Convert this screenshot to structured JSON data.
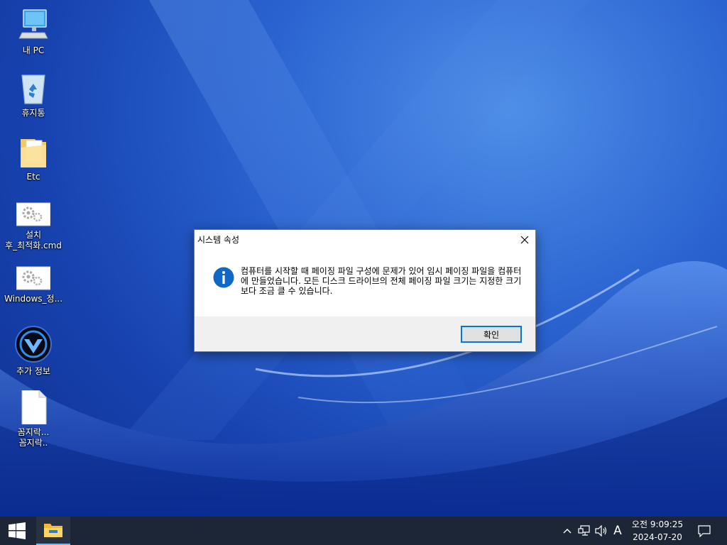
{
  "desktop": {
    "icons": [
      {
        "label": "내 PC",
        "icon": "computer-icon"
      },
      {
        "label": "휴지통",
        "icon": "recycle-bin-icon"
      },
      {
        "label": "Etc",
        "icon": "folder-icon"
      },
      {
        "label": "설치\n후_최적화.cmd",
        "icon": "settings-script-icon"
      },
      {
        "label": "Windows_정...",
        "icon": "settings-script-icon"
      },
      {
        "label": "추가 정보",
        "icon": "info-app-icon"
      },
      {
        "label": "꼼지락...\n꼼지락..",
        "icon": "file-icon"
      }
    ]
  },
  "dialog": {
    "title": "시스템 속성",
    "message": "컴퓨터를 시작할 때 페이징 파일 구성에 문제가 있어 임시 페이징 파일을 컴퓨터에 만들었습니다. 모든 디스크 드라이브의 전체 페이징 파일 크기는 지정한 크기보다 조금 클 수 있습니다.",
    "ok_label": "확인"
  },
  "taskbar": {
    "ime": "A",
    "clock": {
      "time": "오전 9:09:25",
      "date": "2024-07-20"
    }
  },
  "colors": {
    "accent": "#0078d7",
    "taskbar": "#1c2637",
    "info_icon": "#1167c6"
  }
}
